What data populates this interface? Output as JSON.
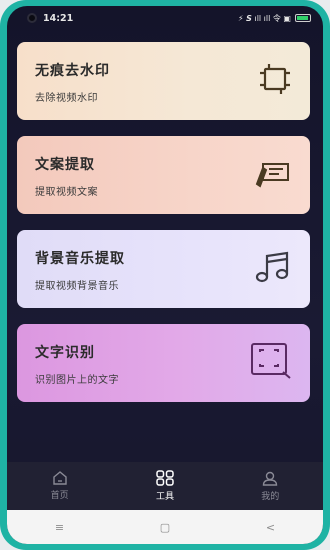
{
  "status_bar": {
    "time": "14:21",
    "right": "⚡ 𝙎 ıll ıll 令 ▣"
  },
  "cards": [
    {
      "title": "无痕去水印",
      "subtitle": "去除视频水印",
      "icon": "crop-frame-icon"
    },
    {
      "title": "文案提取",
      "subtitle": "提取视频文案",
      "icon": "writing-pen-icon"
    },
    {
      "title": "背景音乐提取",
      "subtitle": "提取视频背景音乐",
      "icon": "music-note-icon"
    },
    {
      "title": "文字识别",
      "subtitle": "识别图片上的文字",
      "icon": "scan-text-icon"
    }
  ],
  "bottom_nav": [
    {
      "label": "首页",
      "icon": "home-icon",
      "active": false
    },
    {
      "label": "工具",
      "icon": "tools-grid-icon",
      "active": true
    },
    {
      "label": "我的",
      "icon": "profile-icon",
      "active": false
    }
  ],
  "system_nav": {
    "menu_glyph": "≡",
    "home_glyph": "▢",
    "back_glyph": "<"
  },
  "colors": {
    "frame": "#1fb3a4",
    "background": "#14142a",
    "nav_bg": "#212133",
    "icon_dark": "#4a3a22",
    "scan_icon": "#5a2a63"
  }
}
